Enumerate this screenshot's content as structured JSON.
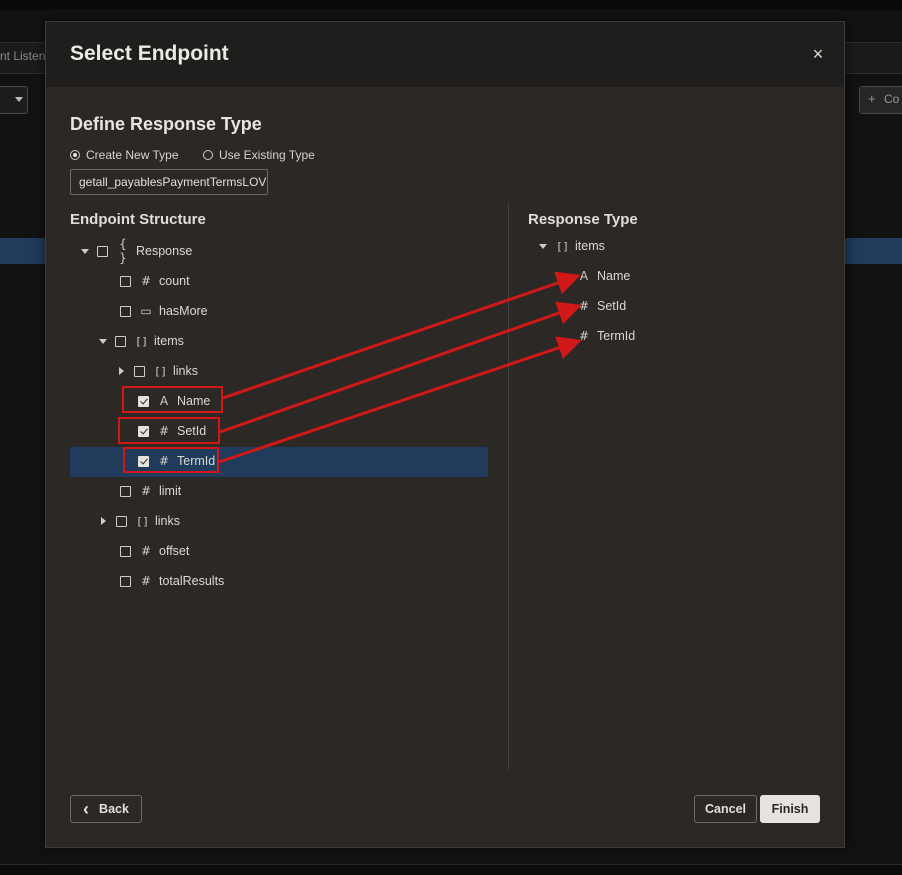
{
  "background": {
    "tab_label": "nt Listen",
    "create_button_icon": "+",
    "create_button_label": "Co"
  },
  "dialog": {
    "title": "Select Endpoint",
    "close_glyph": "×"
  },
  "response_type_section": {
    "title": "Define Response Type",
    "radio_create_label": "Create New Type",
    "radio_existing_label": "Use Existing Type",
    "selected_radio": "Create New Type",
    "type_name_value": "getall_payablesPaymentTermsLOV"
  },
  "endpoint_structure": {
    "title": "Endpoint Structure",
    "nodes": [
      {
        "label": "Response",
        "icon": "{ }",
        "icon_name": "object-icon",
        "checked": false,
        "expand": "expanded"
      },
      {
        "label": "count",
        "icon": "#",
        "icon_name": "number-icon",
        "checked": false
      },
      {
        "label": "hasMore",
        "icon": "▭",
        "icon_name": "boolean-icon",
        "checked": false
      },
      {
        "label": "items",
        "icon": "[ ]",
        "icon_name": "array-icon",
        "checked": false,
        "expand": "expanded"
      },
      {
        "label": "links",
        "icon": "[ ]",
        "icon_name": "array-icon",
        "checked": false,
        "expand": "collapsed"
      },
      {
        "label": "Name",
        "icon": "A",
        "icon_name": "string-icon",
        "checked": true
      },
      {
        "label": "SetId",
        "icon": "#",
        "icon_name": "number-icon",
        "checked": true
      },
      {
        "label": "TermId",
        "icon": "#",
        "icon_name": "number-icon",
        "checked": true,
        "selected": true
      },
      {
        "label": "limit",
        "icon": "#",
        "icon_name": "number-icon",
        "checked": false
      },
      {
        "label": "links",
        "icon": "[ ]",
        "icon_name": "array-icon",
        "checked": false,
        "expand": "collapsed"
      },
      {
        "label": "offset",
        "icon": "#",
        "icon_name": "number-icon",
        "checked": false
      },
      {
        "label": "totalResults",
        "icon": "#",
        "icon_name": "number-icon",
        "checked": false
      }
    ]
  },
  "response_type_tree": {
    "title": "Response Type",
    "nodes": [
      {
        "label": "items",
        "icon": "[ ]",
        "icon_name": "array-icon",
        "expand": "expanded"
      },
      {
        "label": "Name",
        "icon": "A",
        "icon_name": "string-icon"
      },
      {
        "label": "SetId",
        "icon": "#",
        "icon_name": "number-icon"
      },
      {
        "label": "TermId",
        "icon": "#",
        "icon_name": "number-icon"
      }
    ]
  },
  "annotation_color": "#d01818",
  "footer": {
    "back_label": "Back",
    "back_icon": "‹",
    "cancel_label": "Cancel",
    "finish_label": "Finish"
  }
}
